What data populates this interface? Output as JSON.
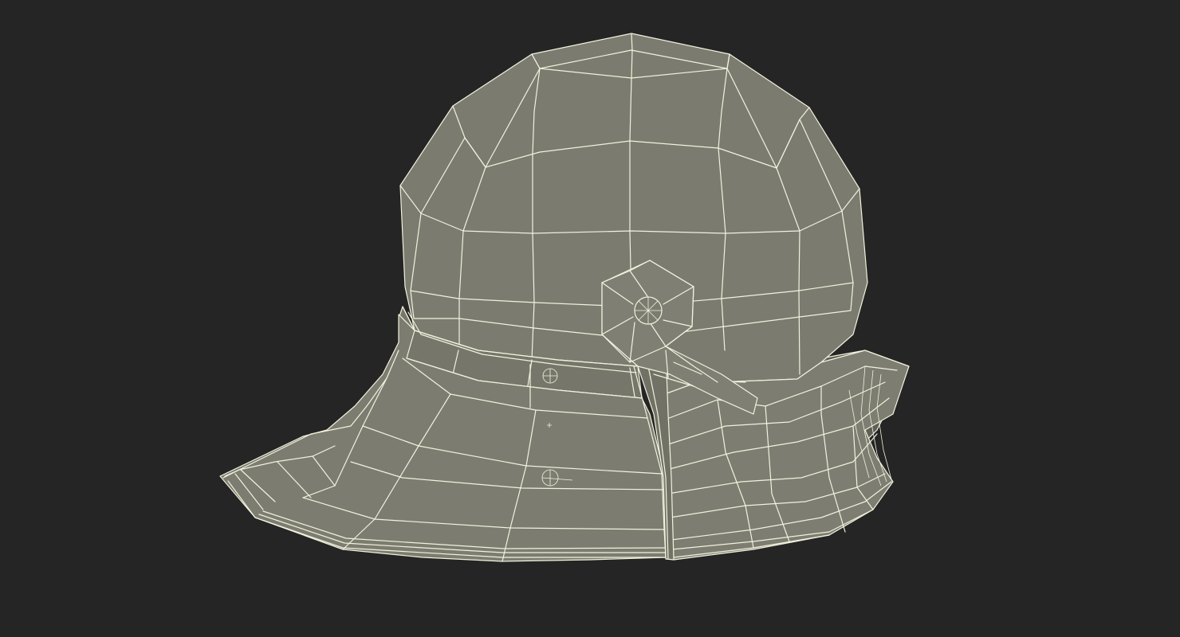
{
  "viewport": {
    "background_color": "#252525",
    "object": "helmet-wireframe-model",
    "surface_color": "#7b7c6f",
    "surface_shadow_color": "#6e6f63",
    "wire_color": "#f3f1de"
  }
}
